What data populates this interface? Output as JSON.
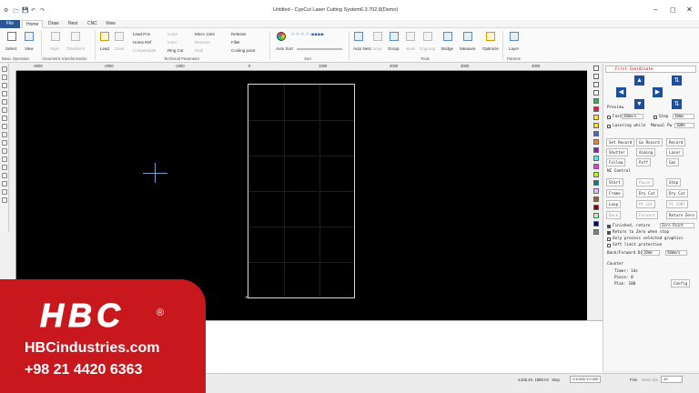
{
  "window": {
    "title": "Untitled - CypCut Laser Cutting System6.3.702.8(Demo)",
    "quick_access": [
      "🗁",
      "💾",
      "↶",
      "↷"
    ],
    "controls": [
      "–",
      "◻",
      "✕"
    ]
  },
  "menu": {
    "file": "File",
    "tabs": [
      "Home",
      "Draw",
      "Nest",
      "CNC",
      "View"
    ]
  },
  "ribbon": {
    "select": "Select",
    "view": "View",
    "style": "Style",
    "transform": "Transform",
    "lead": "Lead",
    "clear": "Clear",
    "lead_pos": "Lead Pos",
    "home_ref": "Home Ref",
    "compensate": "Compensate",
    "outer": "Outer",
    "inner": "Inner",
    "ring_cut": "Ring Cut",
    "micro_joint": "Micro Joint",
    "reverse": "Reverse",
    "seal": "Seal",
    "release": "Release",
    "fillet": "Fillet",
    "cooling_point": "Cooling point",
    "auto_sort": "Auto\nSort",
    "auto_nest": "Auto\nNest",
    "array": "Array",
    "group": "Group",
    "scan": "Scan",
    "ungroup": "Ungroup",
    "bridge": "Bridge",
    "measure": "Measure",
    "optimize": "Optimize",
    "layer": "Layer",
    "groups": {
      "basic": "Basic Operation",
      "geometric": "Geometric transformation",
      "technical": "Technical Parameter",
      "sort": "Sort",
      "tools": "Tools",
      "params": "Params"
    }
  },
  "ruler": {
    "h_ticks": [
      "-3000",
      "-2000",
      "-1000",
      "0",
      "1000",
      "2000",
      "3000",
      "4000"
    ]
  },
  "right_panel": {
    "first_coord": "First Coordinate",
    "preview": "Preview",
    "fast": "Fast",
    "fast_val": "20mm/s",
    "step": "Step",
    "step_val": "10mm",
    "lasering_while": "Lasering while",
    "manual_pwr": "Manual Pw",
    "manual_pwr_val": "100%",
    "set_record": "Set Record",
    "go_record": "Go Record",
    "record": "Record",
    "shutter": "Shutter",
    "aiming": "Aiming",
    "laser": "Laser",
    "follow": "Follow",
    "puff": "Puff",
    "gas": "Gas",
    "nc_control": "NC Control",
    "start": "Start",
    "pause": "Pause",
    "stop": "Stop",
    "frame": "Frame",
    "dry_run": "Dry Cut",
    "loop": "Loop",
    "pt_loc": "Pt LOC",
    "pt_cont": "Pt CONT",
    "back": "Back",
    "forward": "Forward",
    "return_zero": "Return Zero",
    "finished_return": "Finished, return",
    "zero_point": "Zero Point",
    "return_when_stop": "Return to Zero when stop",
    "only_selected": "Only process selected graphics",
    "soft_limit": "Soft limit protection",
    "back_forward_dist": "Back/Forward Dis",
    "back_forward_dist_val": "10mm",
    "back_forward_speed_val": "50mm/s",
    "counter": "Counter",
    "timer": "Timer: 14s",
    "piece": "Piece: 0",
    "plan": "Plan: 100",
    "config": "Config"
  },
  "statusbar": {
    "coords": "-1335.40, 1889.04",
    "stop": "Stop",
    "offset": "X:0.000 Y:0.000",
    "fine": "Fine",
    "move_dis": "Move Dis",
    "move_val": "10"
  },
  "overlay": {
    "logo": "HBC",
    "reg": "®",
    "website": "HBCindustries.com",
    "phone": "+98 21 4420 6363"
  },
  "colors": {
    "accent": "#2b5797",
    "overlay_red": "#c8171d",
    "canvas": "#000000"
  }
}
